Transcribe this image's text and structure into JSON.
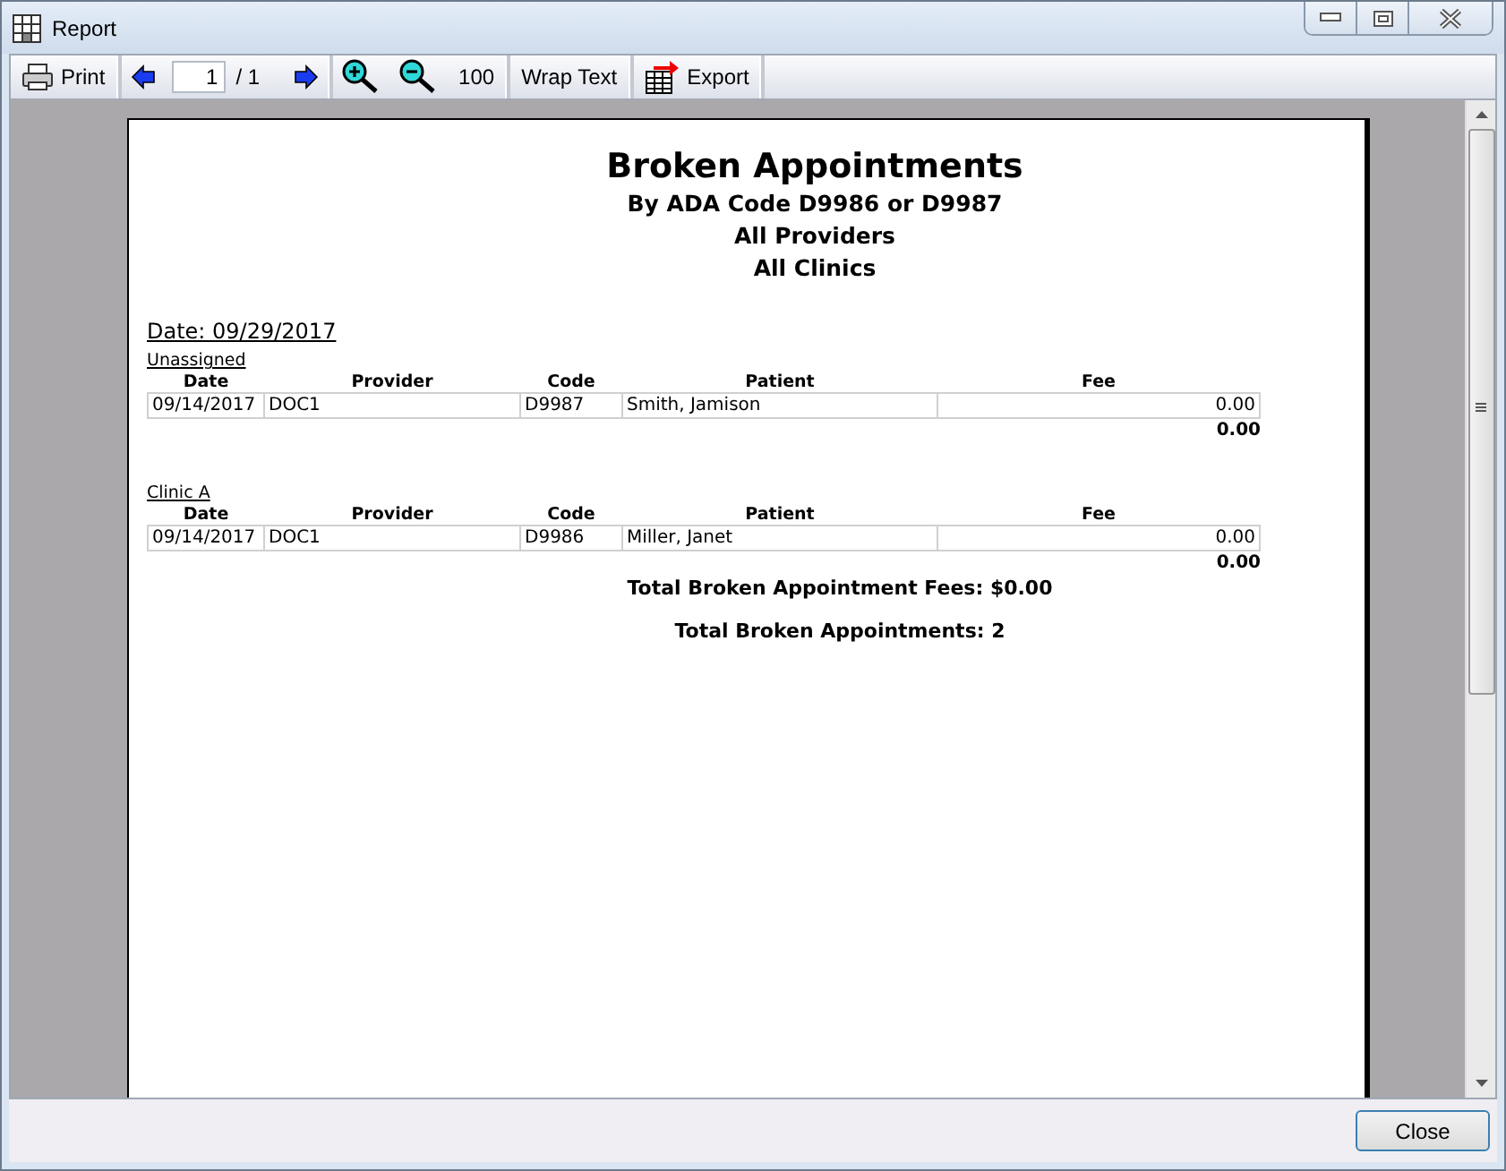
{
  "window": {
    "title": "Report"
  },
  "toolbar": {
    "print": "Print",
    "page": "1",
    "page_total": "/ 1",
    "zoom": "100",
    "wrap": "Wrap Text",
    "export": "Export"
  },
  "report": {
    "title": "Broken Appointments",
    "subtitles": [
      "By ADA Code D9986 or D9987",
      "All Providers",
      "All Clinics"
    ],
    "date": "Date: 09/29/2017",
    "groups": [
      {
        "name": "Unassigned",
        "columns": [
          "Date",
          "Provider",
          "Code",
          "Patient",
          "Fee"
        ],
        "rows": [
          [
            "09/14/2017",
            "DOC1",
            "D9987",
            "Smith, Jamison",
            "0.00"
          ]
        ],
        "subtotal": "0.00"
      },
      {
        "name": "Clinic A",
        "columns": [
          "Date",
          "Provider",
          "Code",
          "Patient",
          "Fee"
        ],
        "rows": [
          [
            "09/14/2017",
            "DOC1",
            "D9986",
            "Miller, Janet",
            "0.00"
          ]
        ],
        "subtotal": "0.00"
      }
    ],
    "totals": [
      "Total Broken Appointment Fees: $0.00",
      "Total Broken Appointments: 2"
    ]
  },
  "buttons": [
    "Close"
  ]
}
